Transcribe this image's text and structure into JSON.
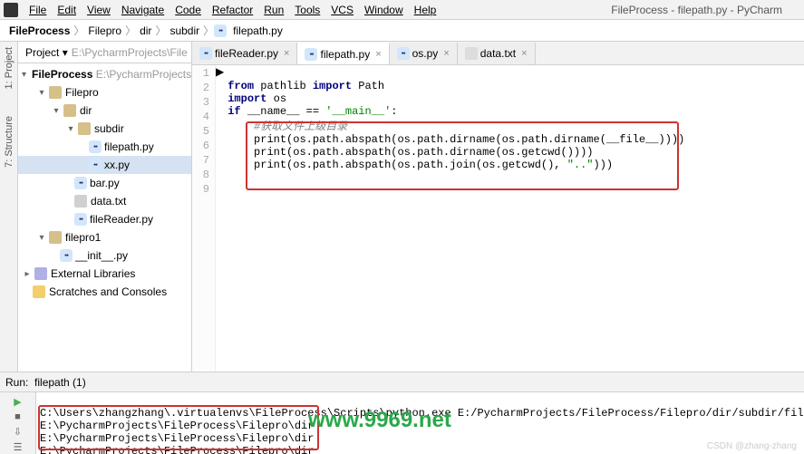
{
  "window": {
    "title": "FileProcess - filepath.py - PyCharm"
  },
  "menu": {
    "items": [
      "File",
      "Edit",
      "View",
      "Navigate",
      "Code",
      "Refactor",
      "Run",
      "Tools",
      "VCS",
      "Window",
      "Help"
    ]
  },
  "breadcrumb": {
    "project": "FileProcess",
    "parts": [
      "Filepro",
      "dir",
      "subdir"
    ],
    "file": "filepath.py"
  },
  "sidebar_tabs": {
    "project": "1: Project",
    "structure": "7: Structure"
  },
  "project_tool": {
    "title": "Project",
    "root_path": "E:\\PycharmProjects\\File",
    "root": "FileProcess",
    "filepro": "Filepro",
    "dir": "dir",
    "subdir": "subdir",
    "filepath_py": "filepath.py",
    "xx_py": "xx.py",
    "bar_py": "bar.py",
    "data_txt": "data.txt",
    "filereader_py": "fileReader.py",
    "filepro1": "filepro1",
    "init_py": "__init__.py",
    "ext_lib": "External Libraries",
    "scratches": "Scratches and Consoles"
  },
  "editor_tabs": {
    "t0": "fileReader.py",
    "t1": "filepath.py",
    "t2": "os.py",
    "t3": "data.txt"
  },
  "code": {
    "line1": {
      "a": "from ",
      "b": "pathlib ",
      "c": "import ",
      "d": "Path"
    },
    "line2": {
      "a": "import ",
      "b": "os"
    },
    "line3": {
      "a": "if ",
      "b": "__name__ == ",
      "c": "'__main__'",
      "d": ":"
    },
    "line4_comment": "    #获取文件上级目录",
    "line5": "    print(os.path.abspath(os.path.dirname(os.path.dirname(__file__))))",
    "line6": "    print(os.path.abspath(os.path.dirname(os.getcwd())))",
    "line7_a": "    print(os.path.abspath(os.path.join(os.getcwd(), ",
    "line7_b": "\"..\"",
    "line7_c": ")))"
  },
  "run": {
    "tab_label": "filepath (1)",
    "header": "Run:",
    "cmd": "C:\\Users\\zhangzhang\\.virtualenvs\\FileProcess\\Scripts\\python.exe E:/PycharmProjects/FileProcess/Filepro/dir/subdir/filepath.py",
    "out1": "E:\\PycharmProjects\\FileProcess\\Filepro\\dir",
    "out2": "E:\\PycharmProjects\\FileProcess\\Filepro\\dir",
    "out3": "E:\\PycharmProjects\\FileProcess\\Filepro\\dir"
  },
  "watermark": "www.9969.net",
  "credit": "CSDN @zhang-zhang"
}
